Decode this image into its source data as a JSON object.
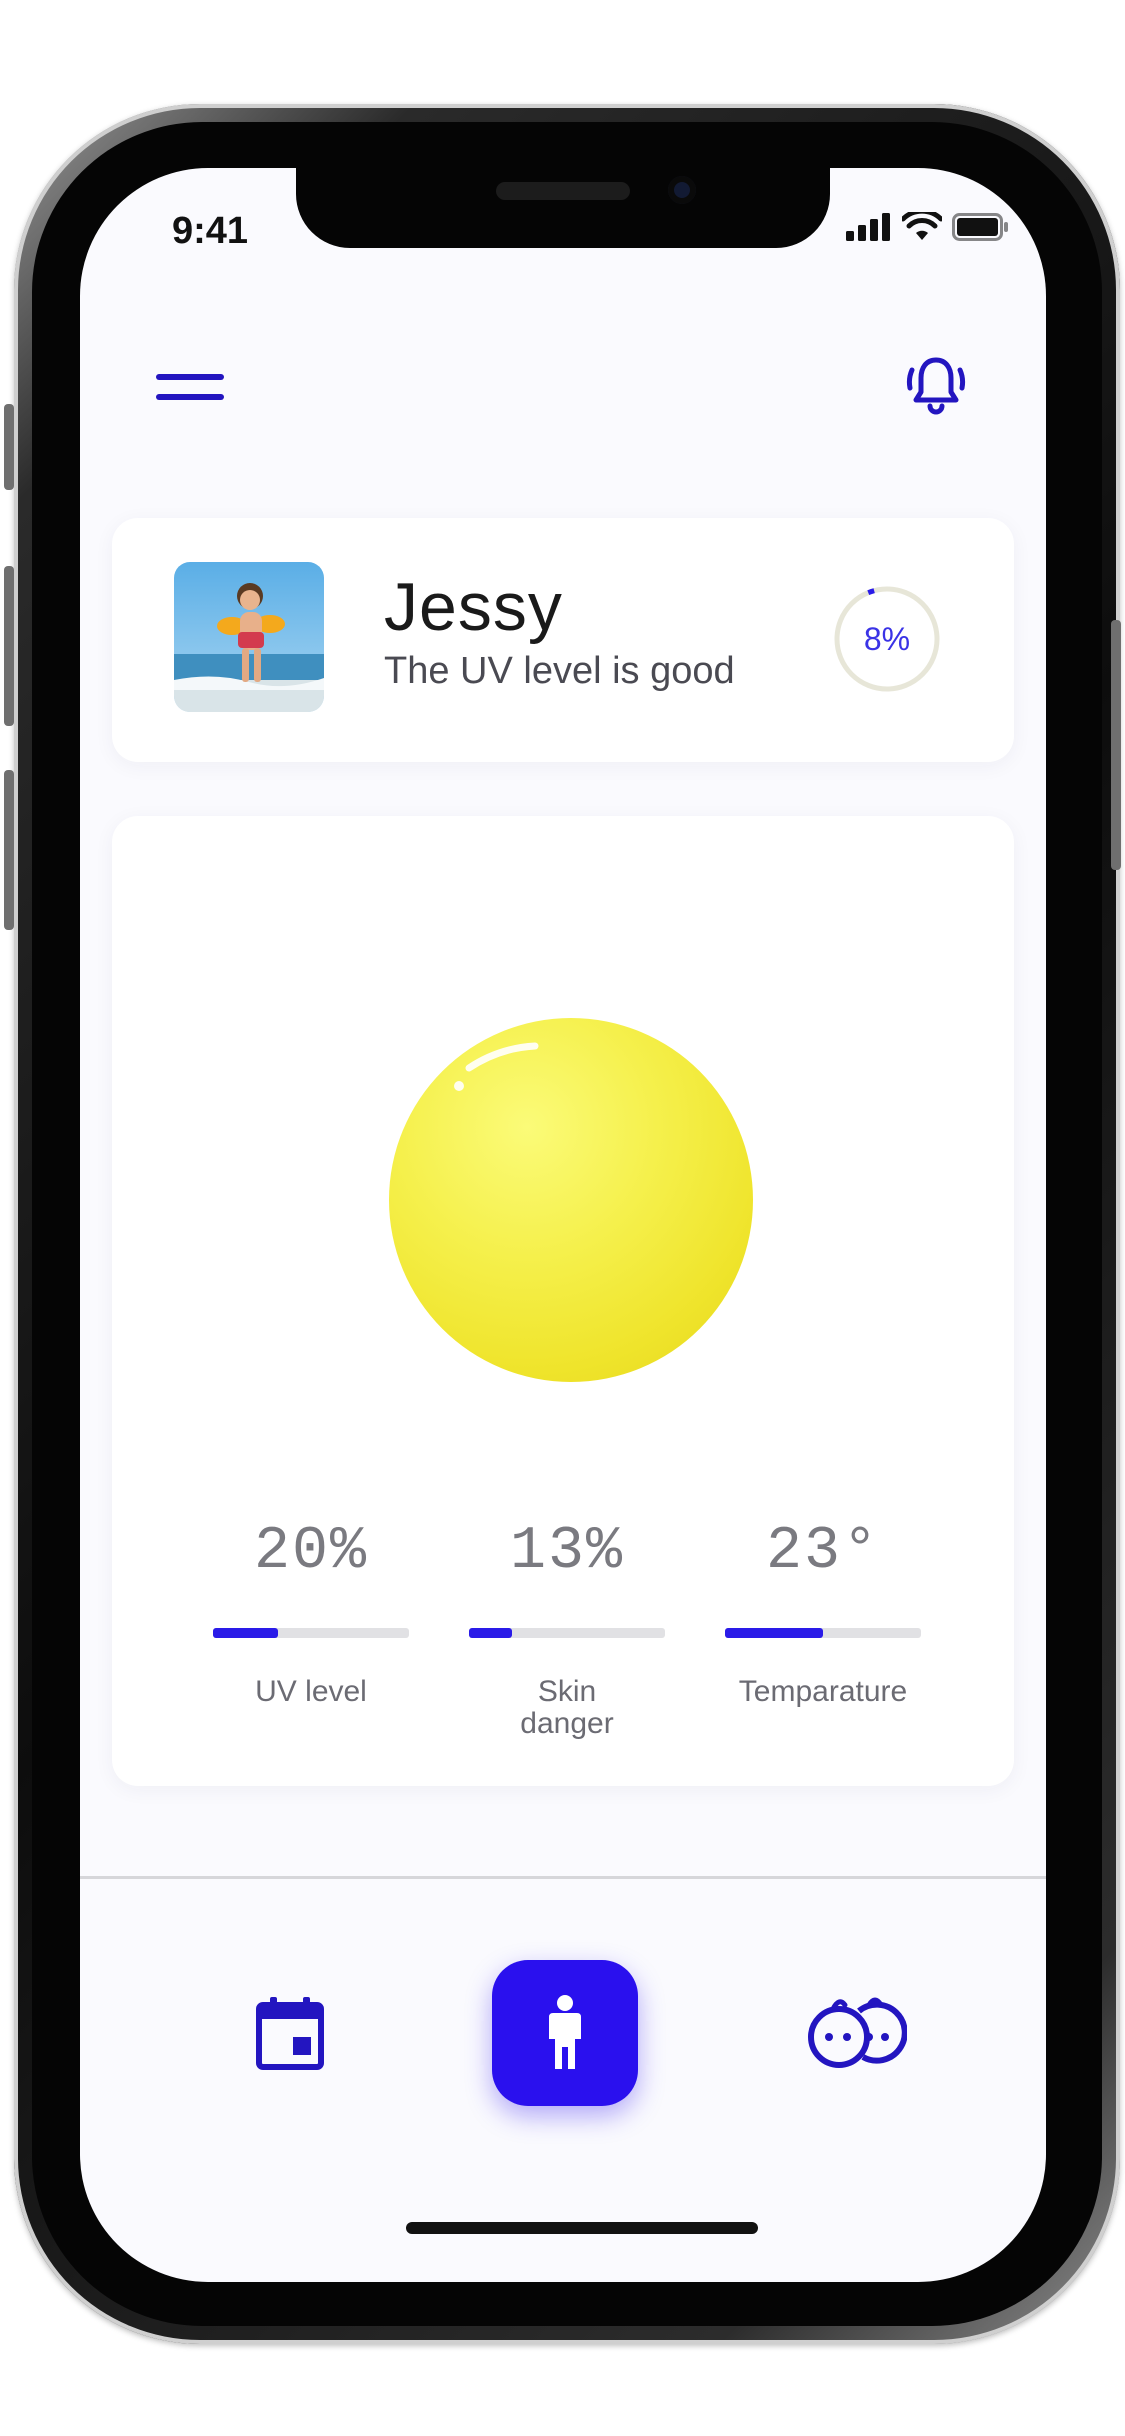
{
  "status_bar": {
    "time": "9:41"
  },
  "profile": {
    "name": "Jessy",
    "status": "The UV level is good",
    "uv_percent_label": "8%",
    "uv_fraction": 0.08
  },
  "stats": [
    {
      "value": "20%",
      "label": "UV level",
      "fill": 0.33
    },
    {
      "value": "13%",
      "label": "Skin\ndanger",
      "fill": 0.22
    },
    {
      "value": "23°",
      "label": "Temparature",
      "fill": 0.5
    }
  ],
  "colors": {
    "accent": "#2a10ee",
    "sun": "#f2ea3a",
    "background": "#fafafe"
  },
  "icons": {
    "menu": "hamburger-icon",
    "notifications": "bell-icon",
    "calendar": "calendar-icon",
    "child": "child-icon",
    "babies": "twins-icon"
  }
}
